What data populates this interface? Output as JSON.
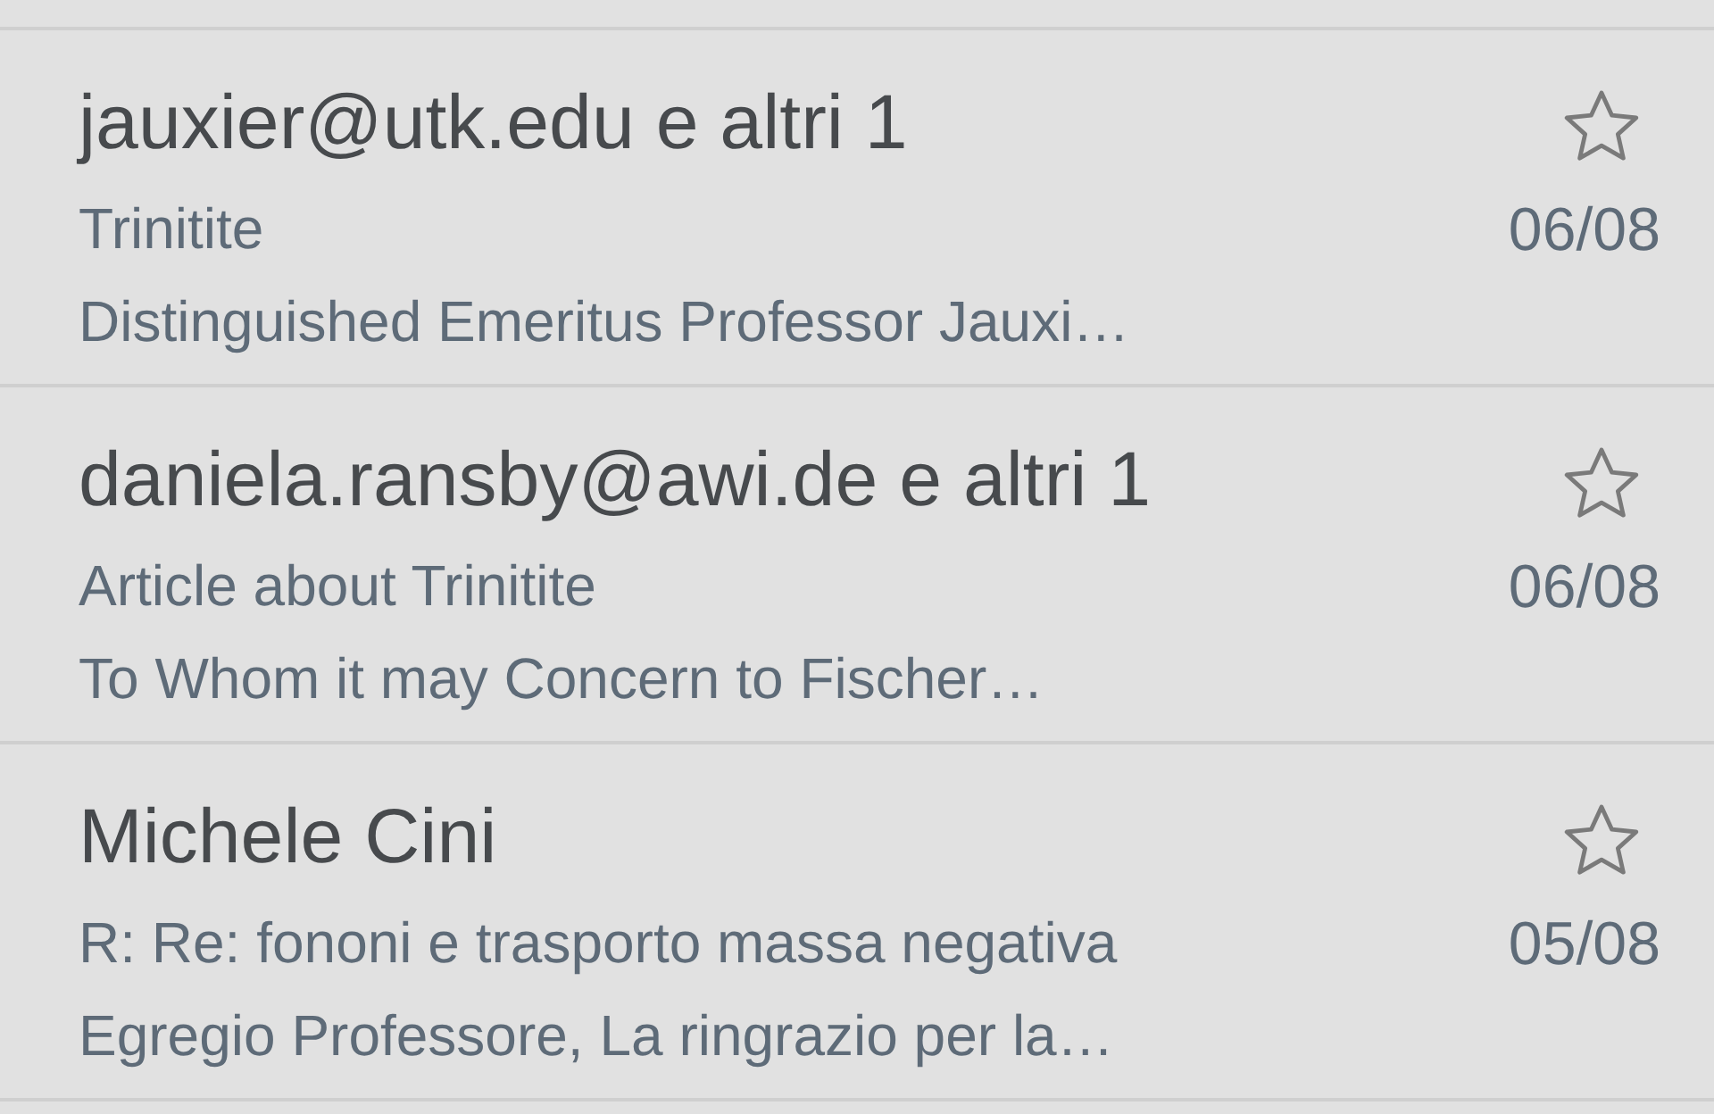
{
  "messages": [
    {
      "sender": "jauxier@utk.edu e altri 1",
      "subject": "Trinitite",
      "snippet": "Distinguished Emeritus Professor Jauxi…",
      "date": "06/08",
      "starred": false
    },
    {
      "sender": "daniela.ransby@awi.de e altri 1",
      "subject": "Article about Trinitite",
      "snippet": "To Whom it may Concern to Fischer…",
      "date": "06/08",
      "starred": false
    },
    {
      "sender": "Michele Cini",
      "subject": "R: Re: fononi e trasporto massa negativa",
      "snippet": "Egregio Professore, La ringrazio per la…",
      "date": "05/08",
      "starred": false
    }
  ]
}
